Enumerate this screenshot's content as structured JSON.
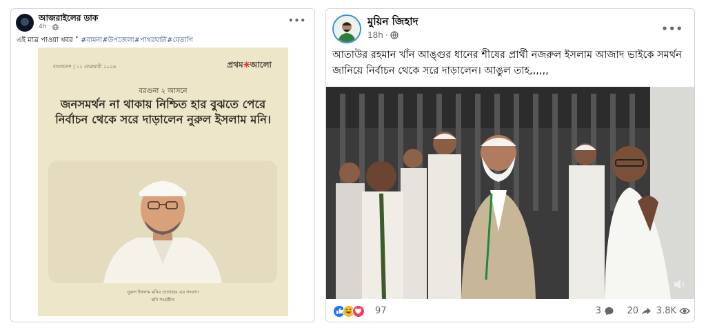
{
  "post_left": {
    "author": "আজরাইলের ডাক",
    "time": "4h",
    "caption_prefix": "এই মাত্র পাওয়া খবর ˚",
    "hashtags": [
      "#বামনা",
      "#উপজেলা",
      "#পাথরঘাটা",
      "#বেতাগি"
    ],
    "card": {
      "date": "বাংলাদেশ | ১১ ফেব্রুয়ারী ২০২৬",
      "logo_part1": "প্রথম",
      "logo_part2": "আলো",
      "subtitle": "বরগুনা ২ আসনে",
      "headline": "জনসমর্থন না থাকায় নিশ্চিত হার বুঝতে পেরে নির্বাচন থেকে সরে দাড়ালেন নুরুল ইসলাম মনি।",
      "credit1": "নুরুল ইসলাম মনির প্রত্যাহার এর সংবাদ।",
      "credit2": "ছবি সংগ্রহীত"
    }
  },
  "post_right": {
    "author": "মুয়িন জিহাদ",
    "time": "18h",
    "text": "আতাউর রহমান খাঁন আঙ্গুর ধানের শীষের প্রার্থী নজরুল ইসলাম আজাদ ভাইকে সমর্থন জানিয়ে নির্বাচন থেকে সরে দাড়ালেন। আঙুল তাহ,,,,,,",
    "reactions_count": "97",
    "comments_count": "3",
    "shares_count": "20",
    "views_count": "3.8K"
  },
  "colors": {
    "link": "#385898",
    "meta": "#65676b",
    "like_blue": "#1877f2",
    "haha_yellow": "#f7b928",
    "love_red": "#f33e58"
  }
}
